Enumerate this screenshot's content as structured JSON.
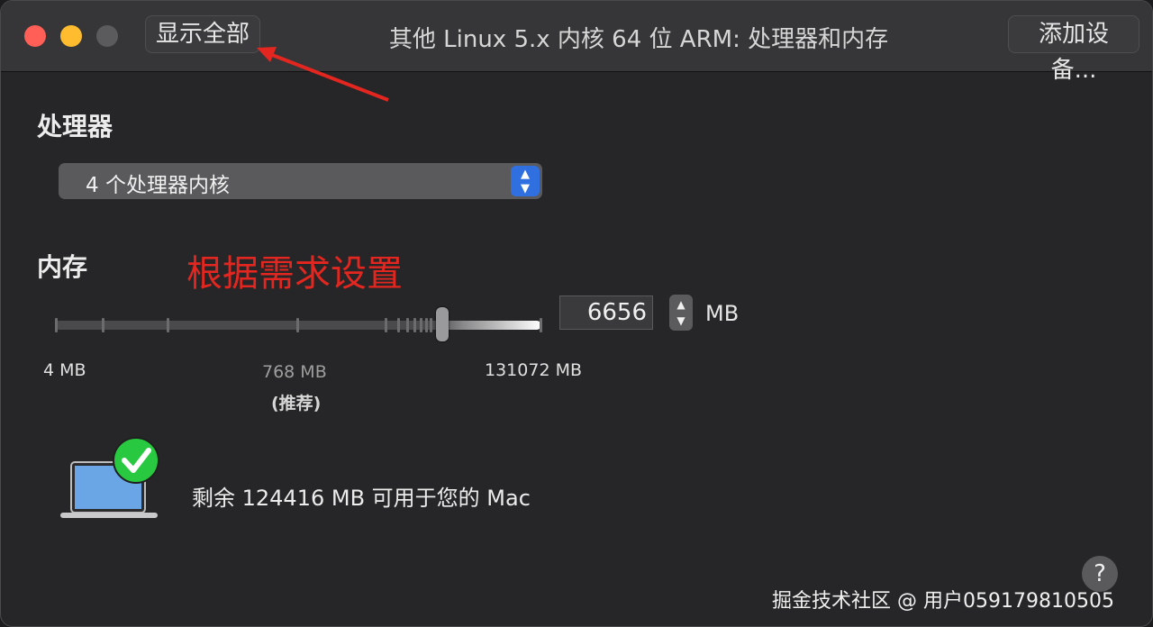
{
  "window": {
    "title": "其他 Linux 5.x 内核 64 位 ARM: 处理器和内存",
    "show_all_label": "显示全部",
    "add_device_label": "添加设备..."
  },
  "processor": {
    "section_label": "处理器",
    "selected": "4 个处理器内核",
    "arrows": "up-down-chevron-icon"
  },
  "memory": {
    "section_label": "内存",
    "annotation": "根据需求设置",
    "value": "6656",
    "unit": "MB",
    "min_label": "4 MB",
    "recommended_label": "768 MB",
    "recommended_note": "(推荐)",
    "max_label": "131072 MB",
    "slider_fraction": 0.79
  },
  "availability": {
    "text": "剩余 124416 MB 可用于您的 Mac",
    "icon": "laptop-check-icon"
  },
  "help_label": "?",
  "watermark": "掘金技术社区 @ 用户059179810505",
  "colors": {
    "annotation": "#e3261f",
    "accent": "#2f6fe0",
    "check": "#28c840",
    "close": "#ff5f57",
    "minimize": "#febc2e"
  }
}
